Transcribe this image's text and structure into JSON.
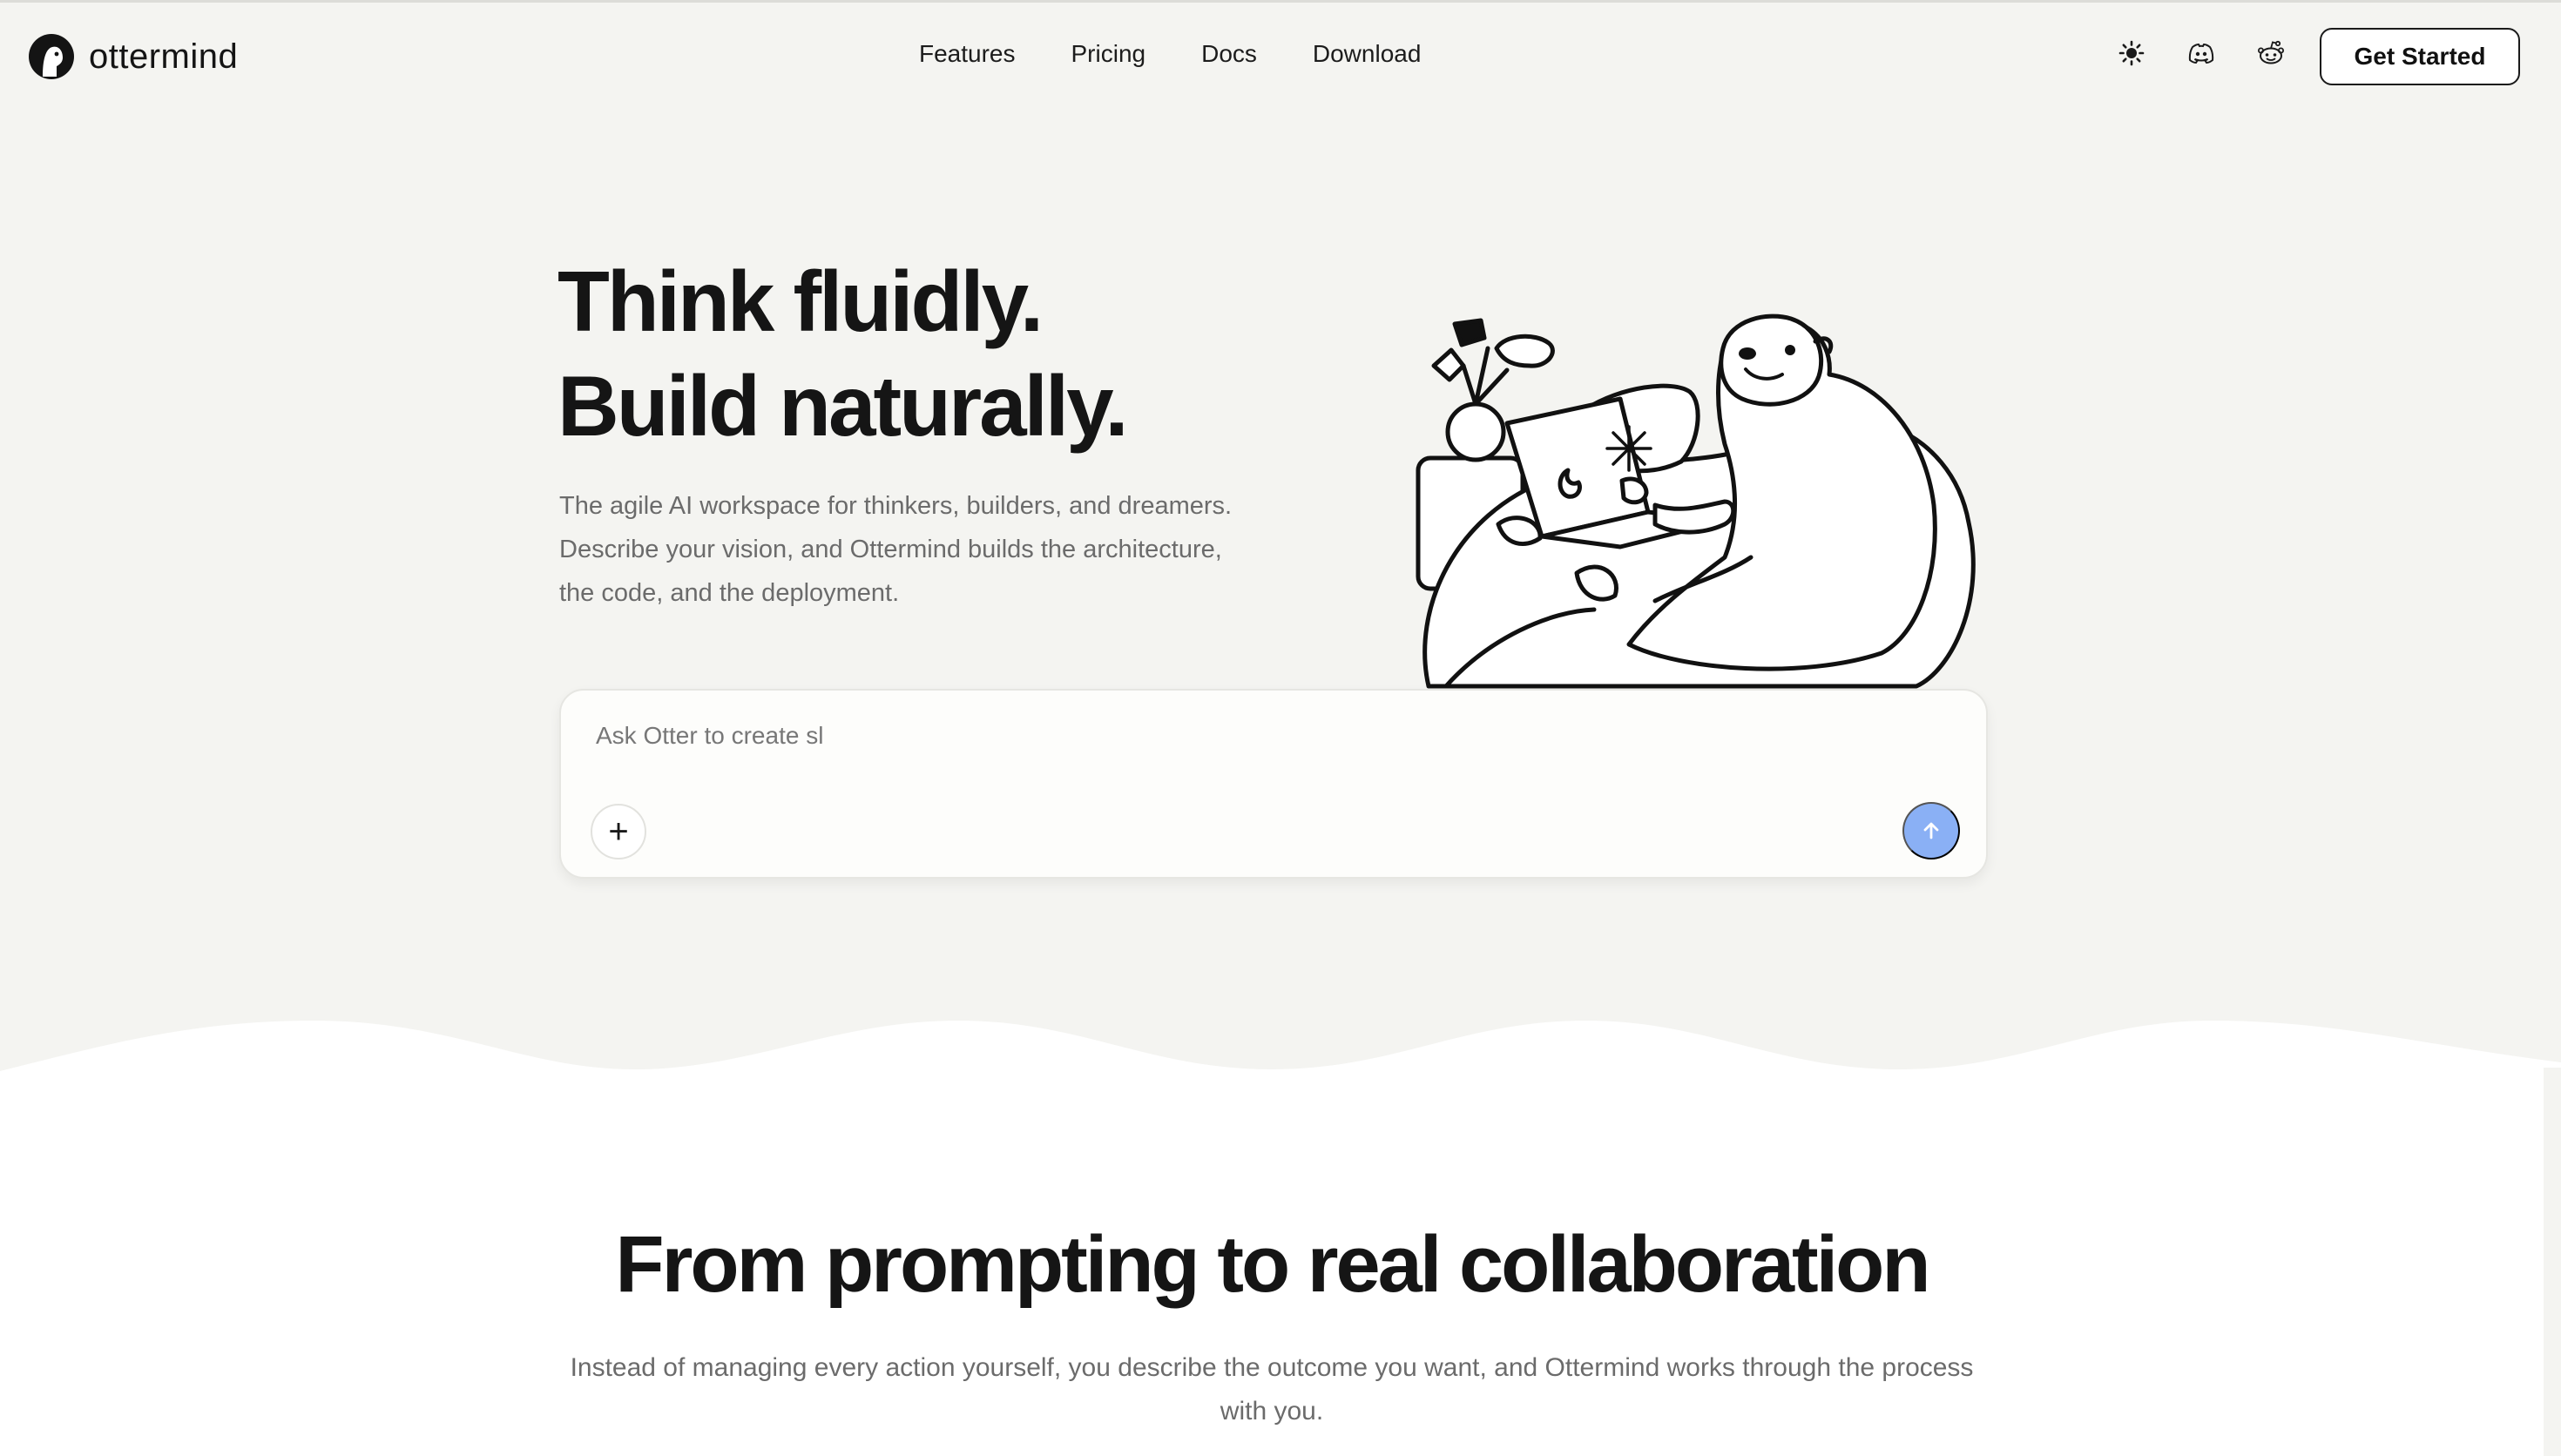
{
  "brand": {
    "name": "ottermind"
  },
  "nav": {
    "items": [
      "Features",
      "Pricing",
      "Docs",
      "Download"
    ]
  },
  "header_icons": [
    "sun-icon",
    "discord-icon",
    "reddit-icon"
  ],
  "cta": {
    "label": "Get Started"
  },
  "hero": {
    "headline_line1": "Think fluidly.",
    "headline_line2": "Build naturally.",
    "subtext_line1": "The agile AI workspace for thinkers, builders, and dreamers.",
    "subtext_line2": "Describe your vision, and Ottermind builds the architecture,",
    "subtext_line3": "the code, and the deployment."
  },
  "prompt": {
    "value": "Ask Otter to create sl",
    "add_label": "+"
  },
  "section": {
    "title": "From prompting to real collaboration",
    "subtitle_line1": "Instead of managing every action yourself, you describe the outcome you want, and Ottermind works through the process",
    "subtitle_line2": "with you."
  },
  "colors": {
    "hero_background": "#f4f4f1",
    "send_button": "#8ab0f5",
    "text_primary": "#151515",
    "text_muted": "#6b6b6b"
  }
}
